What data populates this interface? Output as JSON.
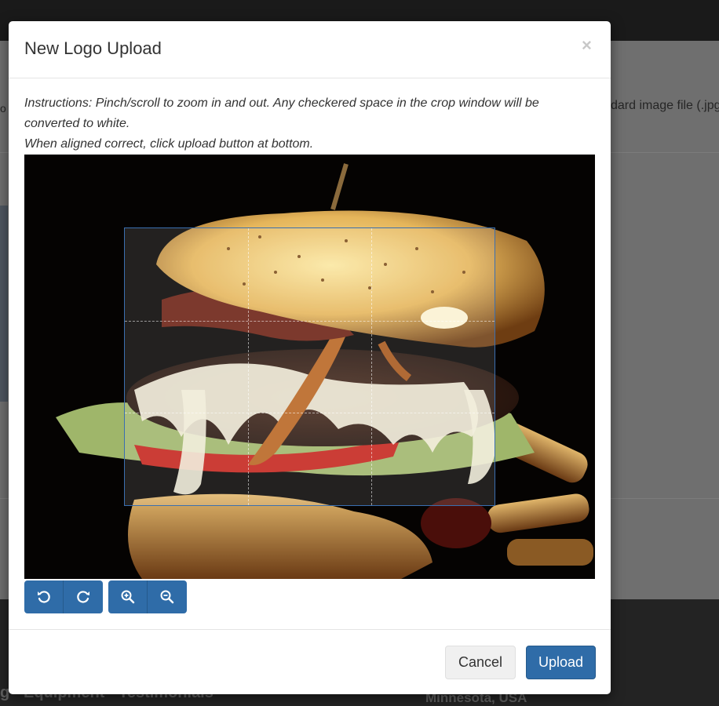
{
  "background": {
    "file_hint": "dard image file (.jpg",
    "left_text": "o",
    "footer_links": "g · Equipment · Testimonials",
    "footer_location": "Minnesota, USA"
  },
  "modal": {
    "title": "New Logo Upload",
    "close_symbol": "×",
    "instructions_line1": "Instructions: Pinch/scroll to zoom in and out. Any checkered space in the crop window will be converted to white.",
    "instructions_line2": "When aligned correct, click upload button at bottom.",
    "toolbar": {
      "rotate_left_icon": "rotate-left-icon",
      "rotate_right_icon": "rotate-right-icon",
      "zoom_in_icon": "zoom-in-icon",
      "zoom_out_icon": "zoom-out-icon"
    },
    "cancel_label": "Cancel",
    "upload_label": "Upload"
  },
  "colors": {
    "primary": "#2f6ca8",
    "overlay": "#6f6f6f",
    "crop_border": "#3a6fb0"
  }
}
